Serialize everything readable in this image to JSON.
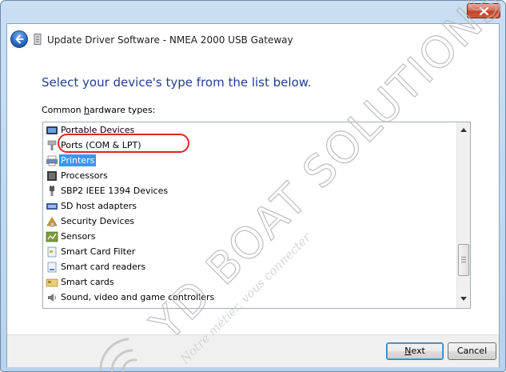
{
  "window": {
    "title": "Update Driver Software - NMEA 2000 USB Gateway",
    "colors": {
      "heading": "#1f3e8f",
      "selection": "#3399ff",
      "annotation": "#e02525"
    }
  },
  "page": {
    "heading": "Select your device's type from the list below.",
    "list_label_pre": "Common ",
    "list_label_mnemonic": "h",
    "list_label_post": "ardware types:"
  },
  "hardware_types": [
    {
      "label": "Portable Devices",
      "icon": "portable-device-icon"
    },
    {
      "label": "Ports (COM & LPT)",
      "icon": "port-plug-icon",
      "annotated": true
    },
    {
      "label": "Printers",
      "icon": "printer-icon",
      "selected": true
    },
    {
      "label": "Processors",
      "icon": "processor-icon"
    },
    {
      "label": "SBP2 IEEE 1394 Devices",
      "icon": "plug-icon"
    },
    {
      "label": "SD host adapters",
      "icon": "sd-adapter-icon"
    },
    {
      "label": "Security Devices",
      "icon": "security-device-icon"
    },
    {
      "label": "Sensors",
      "icon": "sensor-icon"
    },
    {
      "label": "Smart Card Filter",
      "icon": "smart-card-icon"
    },
    {
      "label": "Smart card readers",
      "icon": "smart-card-reader-icon"
    },
    {
      "label": "Smart cards",
      "icon": "smart-cards-icon"
    },
    {
      "label": "Sound, video and game controllers",
      "icon": "speaker-icon"
    }
  ],
  "buttons": {
    "next_mnemonic": "N",
    "next_rest": "ext",
    "cancel": "Cancel"
  },
  "watermark": {
    "main": "YD BOAT SOLUTIONS",
    "tagline": "Notre métier, vous connecter"
  }
}
